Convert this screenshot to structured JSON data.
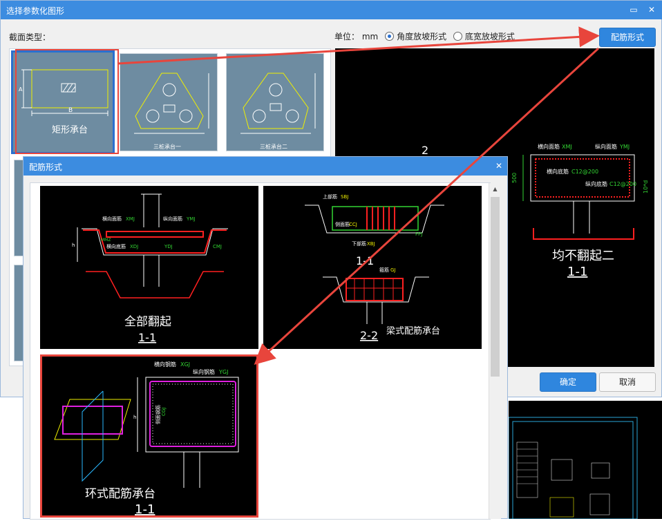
{
  "main_dialog": {
    "title": "选择参数化图形",
    "section_label": "截面类型：",
    "unit_label": "单位：",
    "unit_value": "mm",
    "radio_angle": "角度放坡形式",
    "radio_width": "底宽放坡形式",
    "rebar_button": "配筋形式",
    "ok_button": "确定",
    "cancel_button": "取消"
  },
  "shapes": [
    {
      "name": "矩形承台",
      "dim_a": "A",
      "dim_b": "B"
    },
    {
      "name": "三桩承台一"
    },
    {
      "name": "三桩承台二"
    }
  ],
  "preview": {
    "number": "2",
    "label_transverse": "横向面筋",
    "code_transverse": "XMJ",
    "label_longitudinal": "纵向面筋",
    "code_longitudinal": "YMJ",
    "label_bottom": "横向底筋",
    "spec_bottom": "C12@200",
    "label_bottom_long": "纵向底筋",
    "spec_bottom_long": "C12@200",
    "dim_left": "500",
    "dim_right": "10*d",
    "title": "均不翻起二",
    "section": "1-1"
  },
  "child_dialog": {
    "title": "配筋形式",
    "options": [
      {
        "title": "全部翻起",
        "section": "1-1",
        "labels": {
          "xmj": "横向面筋",
          "xmj_code": "XMJ",
          "ymj": "纵向面筋",
          "ymj_code": "YMJ",
          "bottom": "横向底筋",
          "bottom_code": "XDJ",
          "ydj_code": "YDJ",
          "cmj": "CMJ",
          "mmz": "MMZ",
          "h": "h"
        }
      },
      {
        "title": "梁式配筋承台",
        "section_a": "1-1",
        "section_b": "2-2",
        "labels": {
          "top": "上部筋",
          "top_code": "SBJ",
          "side": "侧面筋",
          "side_code": "CCJ",
          "bottom": "下部筋",
          "bottom_code": "XBJ",
          "stirrup": "箍筋",
          "stirrup_code": "GJ",
          "fpj": "FPJ"
        }
      },
      {
        "title": "环式配筋承台",
        "section": "1-1",
        "labels": {
          "xgj": "横向钢筋",
          "xgj_code": "XGJ",
          "ygj": "纵向钢筋",
          "ygj_code": "YGJ",
          "side": "侧面钢筋",
          "side_code": "CGJ",
          "h": "h"
        }
      }
    ]
  },
  "colors": {
    "title_bar": "#3c8ce0",
    "selection_red": "#e8453c",
    "selection_blue": "#2a6fcf",
    "card_bg": "#6e8ca1",
    "drawing_yellow": "#f0f000",
    "drawing_green": "#33d633",
    "drawing_magenta": "#e020e0",
    "drawing_red": "#ff2020"
  }
}
